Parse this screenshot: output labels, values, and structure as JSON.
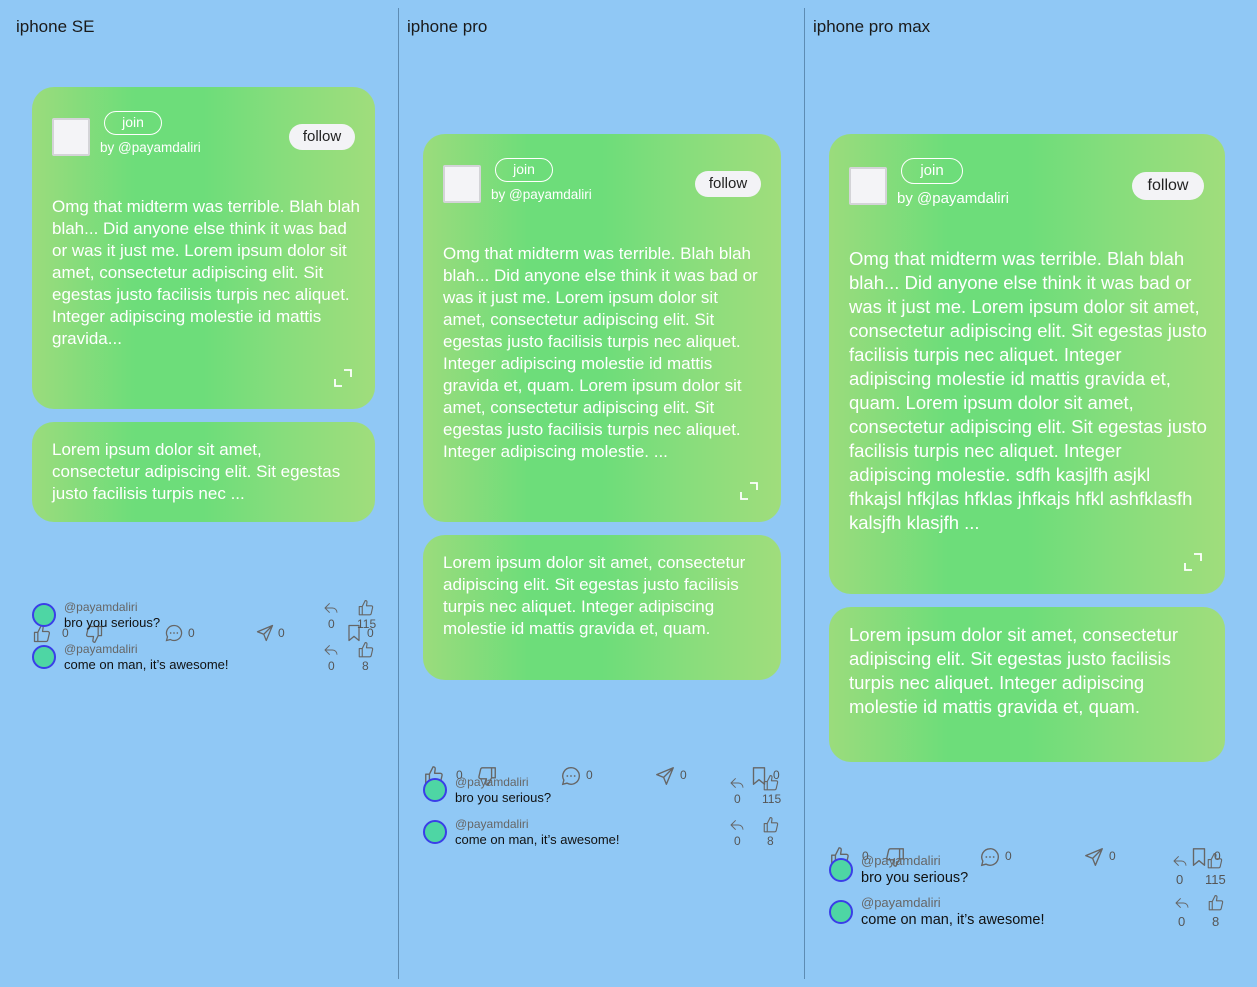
{
  "columns": [
    {
      "title": "iphone SE"
    },
    {
      "title": "iphone pro"
    },
    {
      "title": "iphone pro max"
    }
  ],
  "post": {
    "join_label": "join",
    "byline": "by @payamdaliri",
    "follow_label": "follow",
    "text_se": "Omg that midterm was terrible. Blah blah blah... Did anyone else think it was bad or was it just me. Lorem ipsum dolor sit amet, consectetur adipiscing elit. Sit egestas justo facilisis turpis nec aliquet. Integer adipiscing molestie id mattis gravida...",
    "text_pro": "Omg that midterm was terrible. Blah blah blah... Did anyone else think it was bad or was it just me. Lorem ipsum dolor sit amet, consectetur adipiscing elit. Sit egestas justo facilisis turpis nec aliquet. Integer adipiscing molestie id mattis gravida et, quam. Lorem ipsum dolor sit amet, consectetur adipiscing elit. Sit egestas justo facilisis turpis nec aliquet. Integer adipiscing molestie. ...",
    "text_promax": "Omg that midterm was terrible. Blah blah blah... Did anyone else think it was bad or was it just me. Lorem ipsum dolor sit amet, consectetur adipiscing elit. Sit egestas justo facilisis turpis nec aliquet. Integer adipiscing molestie id mattis gravida et, quam. Lorem ipsum dolor sit amet, consectetur adipiscing elit. Sit egestas justo facilisis turpis nec aliquet. Integer adipiscing molestie. sdfh kasjlfh asjkl fhkajsl hfkjlas hfklas jhfkajs hfkl ashfklasfh kalsjfh klasjfh ..."
  },
  "reply": {
    "text_se": "Lorem ipsum dolor sit amet, consectetur adipiscing elit. Sit egestas justo facilisis turpis nec ...",
    "text_full": "Lorem ipsum dolor sit amet, consectetur adipiscing elit. Sit egestas justo facilisis turpis nec aliquet. Integer adipiscing molestie id mattis gravida et, quam."
  },
  "actions": {
    "like_count": "0",
    "dislike_count": "0",
    "comment_count": "0",
    "share_count": "0",
    "save_count": "0"
  },
  "comments": [
    {
      "user": "@payamdaliri",
      "text": "bro you serious?",
      "reply_count": "0",
      "like_count": "115"
    },
    {
      "user": "@payamdaliri",
      "text": "come on man, it’s awesome!",
      "reply_count": "0",
      "like_count": "8"
    }
  ],
  "colors": {
    "background": "#90c8f5",
    "card_gradient_mid": "#6ddd7a",
    "card_gradient_edge": "#a0dd7c",
    "avatar_ring": "#3a3ee8",
    "avatar_fill": "#4ed6a4"
  }
}
